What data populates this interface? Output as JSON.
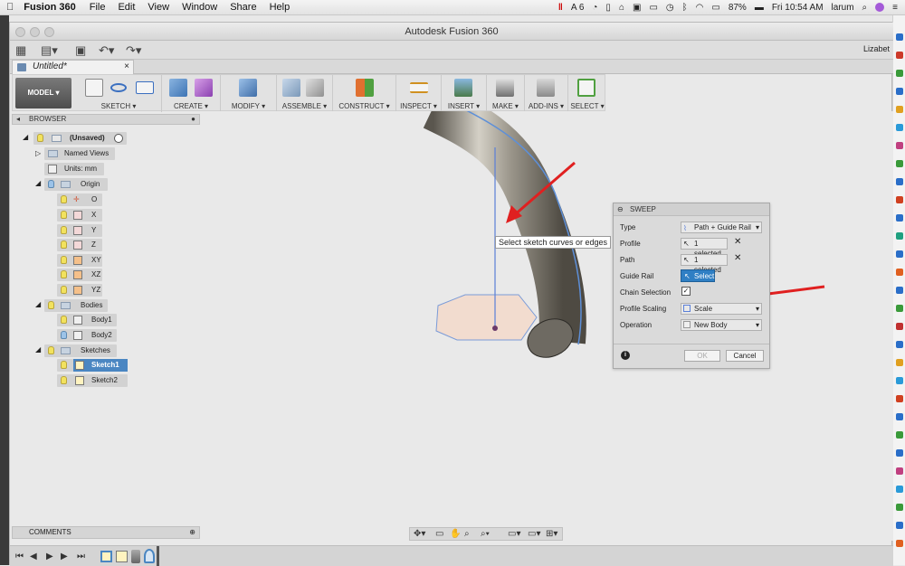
{
  "menubar": {
    "app": "Fusion 360",
    "items": [
      "File",
      "Edit",
      "View",
      "Window",
      "Share",
      "Help"
    ],
    "badge_num": "6",
    "battery": "87%",
    "clock": "Fri 10:54 AM",
    "user": "larum"
  },
  "window": {
    "title": "Autodesk Fusion 360",
    "user_partial": "Lizabet"
  },
  "tab": {
    "name": "Untitled*"
  },
  "toolbar": {
    "model": "MODEL",
    "groups": [
      "SKETCH",
      "CREATE",
      "MODIFY",
      "ASSEMBLE",
      "CONSTRUCT",
      "INSPECT",
      "INSERT",
      "MAKE",
      "ADD-INS",
      "SELECT"
    ]
  },
  "browser": {
    "title": "BROWSER",
    "root": "(Unsaved)",
    "named_views": "Named Views",
    "units": "Units: mm",
    "origin": "Origin",
    "origin_items": [
      "O",
      "X",
      "Y",
      "Z",
      "XY",
      "XZ",
      "YZ"
    ],
    "bodies": "Bodies",
    "body_items": [
      "Body1",
      "Body2"
    ],
    "sketches": "Sketches",
    "sketch_items": [
      "Sketch1",
      "Sketch2"
    ]
  },
  "viewport": {
    "tooltip": "Select sketch curves or edges"
  },
  "sweep": {
    "title": "SWEEP",
    "type_label": "Type",
    "type_value": "Path + Guide Rail",
    "profile_label": "Profile",
    "profile_value": "1 selected",
    "path_label": "Path",
    "path_value": "1 selected",
    "guide_label": "Guide Rail",
    "guide_value": "Select",
    "chain_label": "Chain Selection",
    "scaling_label": "Profile Scaling",
    "scaling_value": "Scale",
    "operation_label": "Operation",
    "operation_value": "New Body",
    "ok": "OK",
    "cancel": "Cancel"
  },
  "comments": {
    "title": "COMMENTS"
  },
  "colors": {
    "accent": "#2f7fc4",
    "arrow": "#e02020"
  }
}
